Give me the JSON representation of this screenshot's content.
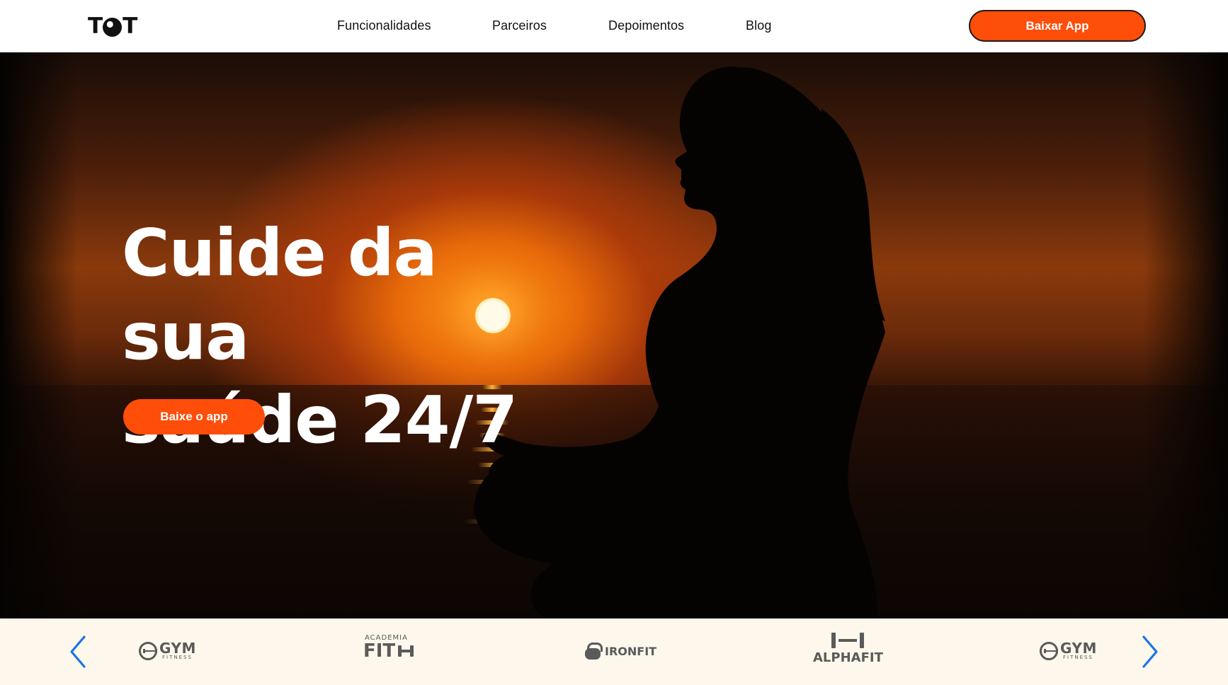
{
  "header": {
    "logo_text_left": "T",
    "logo_text_right": "T",
    "nav": [
      "Funcionalidades",
      "Parceiros",
      "Depoimentos",
      "Blog"
    ],
    "cta_label": "Baixar App"
  },
  "hero": {
    "title_line1": "Cuide da sua",
    "title_line2": "saúde 24/7",
    "cta_label": "Baixe o app"
  },
  "partners": {
    "logos": [
      {
        "name": "gym-fitness",
        "big": "GYM",
        "small": "FITNESS"
      },
      {
        "name": "academia-fit",
        "small": "ACADEMIA",
        "big": "FIT"
      },
      {
        "name": "ironfit",
        "big": "IRONFIT"
      },
      {
        "name": "alphafit",
        "big": "ALPHAFIT"
      },
      {
        "name": "gym-fitness-2",
        "big": "GYM",
        "small": "FITNESS"
      }
    ]
  },
  "colors": {
    "accent": "#ff4d0a",
    "header_bg": "#ffffff",
    "partners_bg": "#fdf7ec",
    "arrow": "#1a73e8",
    "logo_gray": "#5a5a5a"
  },
  "icons": [
    "globe-icon",
    "chevron-left-icon",
    "chevron-right-icon",
    "dumbbell-icon",
    "kettlebell-icon"
  ]
}
